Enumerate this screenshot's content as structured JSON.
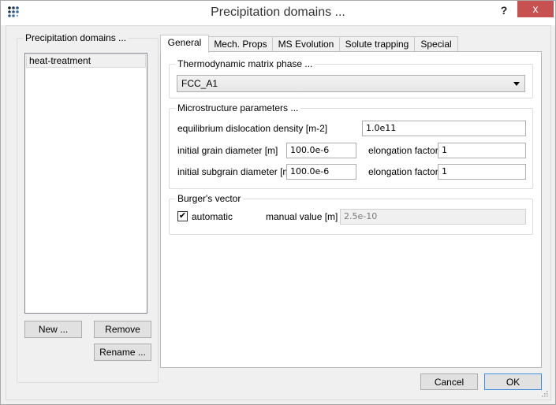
{
  "window": {
    "title": "Precipitation domains ...",
    "help_label": "?",
    "close_label": "x"
  },
  "left_panel": {
    "group_title": "Precipitation domains ...",
    "items": [
      {
        "label": "heat-treatment",
        "selected": true
      }
    ],
    "new_button": "New ...",
    "remove_button": "Remove",
    "rename_button": "Rename ..."
  },
  "tabs": [
    {
      "label": "General",
      "active": true
    },
    {
      "label": "Mech. Props",
      "active": false
    },
    {
      "label": "MS Evolution",
      "active": false
    },
    {
      "label": "Solute trapping",
      "active": false
    },
    {
      "label": "Special",
      "active": false
    }
  ],
  "general": {
    "matrix_phase": {
      "group_title": "Thermodynamic matrix phase ...",
      "selected": "FCC_A1"
    },
    "microstructure": {
      "group_title": "Microstructure parameters ...",
      "dislocation_density_label": "equilibrium dislocation density  [m-2]",
      "dislocation_density_value": "1.0e11",
      "grain_diameter_label": "initial grain diameter [m]",
      "grain_diameter_value": "100.0e-6",
      "grain_elongation_label": "elongation factor",
      "grain_elongation_value": "1",
      "subgrain_diameter_label": "initial subgrain diameter [m]",
      "subgrain_diameter_value": "100.0e-6",
      "subgrain_elongation_label": "elongation factor",
      "subgrain_elongation_value": "1"
    },
    "burgers": {
      "group_title": "Burger's vector",
      "automatic_label": "automatic",
      "automatic_checked": true,
      "check_glyph": "✔",
      "manual_label": "manual value [m]",
      "manual_value": "2.5e-10"
    }
  },
  "footer": {
    "cancel_button": "Cancel",
    "ok_button": "OK"
  },
  "colors": {
    "close_button": "#c75050",
    "default_button_border": "#3c8fdf",
    "app_icon_dark": "#1f3a5c",
    "app_icon_mid": "#3b6ea5"
  }
}
